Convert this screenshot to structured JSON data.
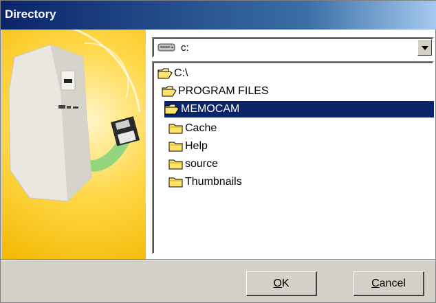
{
  "window": {
    "title": "Directory"
  },
  "drive": {
    "label": "c:"
  },
  "tree": {
    "items": [
      {
        "label": "C:\\",
        "level": 0,
        "selected": false,
        "open": true
      },
      {
        "label": "PROGRAM FILES",
        "level": 1,
        "selected": false,
        "open": true
      },
      {
        "label": "MEMOCAM",
        "level": 2,
        "selected": true,
        "open": true
      },
      {
        "label": "Cache",
        "level": 3,
        "selected": false,
        "open": false
      },
      {
        "label": "Help",
        "level": 3,
        "selected": false,
        "open": false
      },
      {
        "label": "source",
        "level": 3,
        "selected": false,
        "open": false
      },
      {
        "label": "Thumbnails",
        "level": 3,
        "selected": false,
        "open": false
      }
    ]
  },
  "buttons": {
    "ok_mnemonic": "O",
    "ok_rest": "K",
    "cancel_mnemonic": "C",
    "cancel_rest": "ancel"
  },
  "colors": {
    "title_bar": "#0a246a",
    "selection": "#0a246a",
    "dialog_face": "#d4d0c8",
    "art_background": "#ffd84a"
  }
}
